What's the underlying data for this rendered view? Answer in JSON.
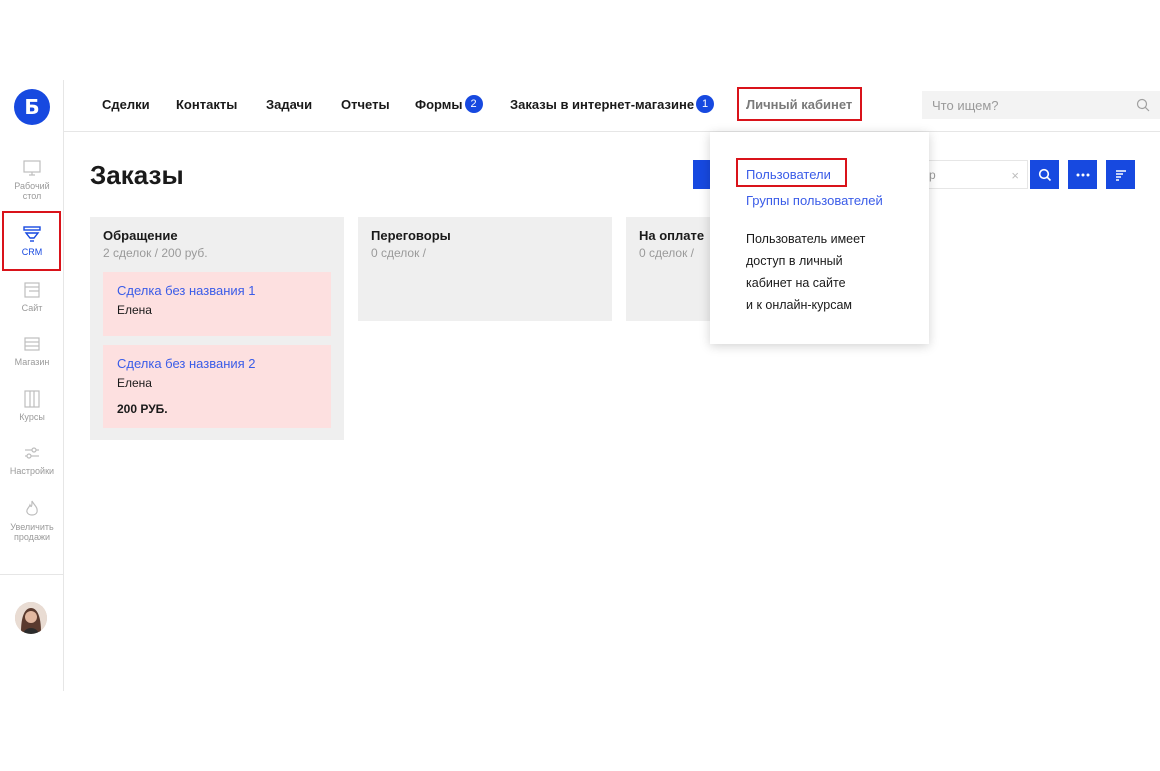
{
  "sidebar": {
    "logo": "Б",
    "items": [
      {
        "label": "Рабочий стол",
        "icon": "monitor-icon"
      },
      {
        "label": "CRM",
        "icon": "funnel-icon",
        "active": true
      },
      {
        "label": "Сайт",
        "icon": "site-icon"
      },
      {
        "label": "Магазин",
        "icon": "store-icon"
      },
      {
        "label": "Курсы",
        "icon": "courses-icon"
      },
      {
        "label": "Настройки",
        "icon": "settings-sliders-icon"
      },
      {
        "label": "Увеличить продажи",
        "icon": "flame-icon"
      }
    ]
  },
  "topnav": {
    "items": [
      {
        "label": "Сделки"
      },
      {
        "label": "Контакты"
      },
      {
        "label": "Задачи"
      },
      {
        "label": "Отчеты"
      },
      {
        "label": "Формы",
        "badge": "2"
      },
      {
        "label": "Заказы в интернет-магазине",
        "badge": "1"
      },
      {
        "label": "Личный кабинет"
      }
    ],
    "search_placeholder": "Что ищем?"
  },
  "main": {
    "title": "Заказы",
    "search_placeholder_fragment": "р",
    "clear_glyph": "×"
  },
  "columns": [
    {
      "title": "Обращение",
      "subtitle": "2 сделок / 200 руб.",
      "cards": [
        {
          "title": "Сделка без названия 1",
          "contact": "Елена"
        },
        {
          "title": "Сделка без названия 2",
          "contact": "Елена",
          "price": "200 РУБ."
        }
      ]
    },
    {
      "title": "Переговоры",
      "subtitle": "0 сделок /"
    },
    {
      "title": "На оплате",
      "subtitle": "0 сделок /"
    }
  ],
  "dropdown": {
    "items": [
      {
        "label": "Пользователи"
      },
      {
        "label": "Группы пользователей"
      }
    ],
    "description_lines": [
      "Пользователь имеет",
      "доступ в личный",
      "кабинет на сайте",
      "и к онлайн-курсам"
    ]
  },
  "colors": {
    "accent": "#1749e0",
    "link": "#3a5ce8",
    "highlight": "#d9131a",
    "card": "#fde0e0",
    "column": "#efefef"
  }
}
